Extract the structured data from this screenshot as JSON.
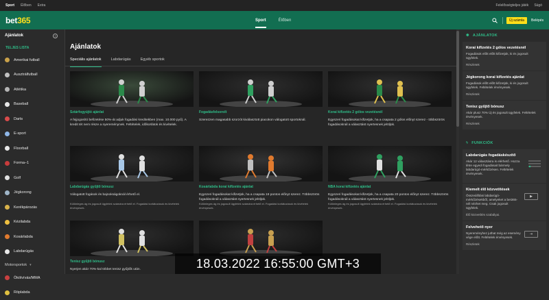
{
  "topbar": {
    "links": [
      "Sport",
      "Élőben",
      "Extra"
    ],
    "right_links": [
      "Felelősségteljes játék",
      "Súgó"
    ]
  },
  "header": {
    "logo_a": "bet",
    "logo_b": "365",
    "tabs": [
      "Sport",
      "Élőben"
    ],
    "join_label": "Új számla",
    "login_label": "Belépés"
  },
  "sidebar": {
    "title": "Ajánlatok",
    "section_title": "TELJES LISTA",
    "items": [
      {
        "label": "Amerikai futball",
        "color": "#c9a14a"
      },
      {
        "label": "Ausztrálfutball",
        "color": "#c0c0c0"
      },
      {
        "label": "Atlétika",
        "color": "#b5b5b5"
      },
      {
        "label": "Baseball",
        "color": "#e6e6e6"
      },
      {
        "label": "Darts",
        "color": "#d94b4b"
      },
      {
        "label": "E-sport",
        "color": "#8fb7e8"
      },
      {
        "label": "Floorball",
        "color": "#e8e8e8"
      },
      {
        "label": "Forma–1",
        "color": "#c93c3c"
      },
      {
        "label": "Golf",
        "color": "#e0e0e0"
      },
      {
        "label": "Jégkorong",
        "color": "#9fb5c8"
      },
      {
        "label": "Kerékpározás",
        "color": "#d8b24a"
      },
      {
        "label": "Kézilabda",
        "color": "#f0c040"
      },
      {
        "label": "Kosárlabda",
        "color": "#e07a2e"
      },
      {
        "label": "Labdarúgás",
        "color": "#e8e8e8"
      }
    ],
    "motorsport_label": "Motorsportok",
    "more_items": [
      {
        "label": "Ökölvívás/MMA",
        "color": "#c94040"
      },
      {
        "label": "Röplabda",
        "color": "#e0c040"
      }
    ]
  },
  "main": {
    "title": "Ajánlatok",
    "tabs": [
      "Speciális ajánlatok",
      "Labdarúgás",
      "Egyéb sportok"
    ],
    "cards": [
      {
        "title": "Sztárfogyújtó ajánlat",
        "desc": "A fejjogosító befizetése 50%-át adjuk fogadási kreditekben (max. 10.000 pyű). A kredit tét nem része a nyereménynek. Feltételek, időkorlátok és kivételek.",
        "small": ""
      },
      {
        "title": "Fogadásfelsorolt",
        "desc": "Szerezzen magasabb szorzót kiválasztott piacokon válogatott sportoknál.",
        "small": ""
      },
      {
        "title": "Korai kifizetés 2 gólos vezetésnél",
        "desc": "Egyszeri fogadásokat kifizetjük, ha a csapata 2 gólos előnyt szerez - többszörös fogadásoknál a választást nyertesnek jelöljük.",
        "small": ""
      },
      {
        "title": "Labdarúgás gyűjtő bónusz",
        "desc": "Válogatott fogások és bajnokságoknál érhető el.",
        "small": "Különleges ág és jogosult ügyfelek számára érhető el. Fogadási korlátozások és kivételek érvényesek."
      },
      {
        "title": "Kosárlabda korai kifizetés ajánlat",
        "desc": "Egyszeri fogadásokat kifizetjük, ha a csapata 18 pontos előnyt szerez. Többszörös fogadásoknál a választást nyertesnek jelöljük.",
        "small": "Különleges ág és jogosult ügyfelek számára érhető el. Fogadási korlátozások és kivételek érvényesek."
      },
      {
        "title": "NBA korai kifizetés ajánlat",
        "desc": "Egyszeri fogadásokat kifizetjük, ha a csapata 20 pontos előnyt szerez. Többszörös fogadásoknál a választást nyertesnek jelöljük.",
        "small": "Különleges ág és jogosult ügyfelek számára érhető el. Fogadási korlátozások és kivételek érvényesek."
      },
      {
        "title": "Tenisz gyűjtő bónusz",
        "desc": "Nyerjen akár 70%-kal többet tenisz gyűjtők után.",
        "small": ""
      },
      {
        "title": "",
        "desc": "",
        "small": ""
      }
    ]
  },
  "right": {
    "offers_title": "AJÁNLATOK",
    "offers": [
      {
        "title": "Korai kifizetés 2 gólos vezetésnél",
        "desc": "Fogadások előtt előtt kifizetjük, ki és jogosult ügyfelek.",
        "link": "Részletek"
      },
      {
        "title": "Jégkorong korai kifizetés ajánlat",
        "desc": "Fogadások előtt előtt kifizetjük, ki és jogosult ügyfelek. Feltételek érvényesek.",
        "link": "Részletek"
      },
      {
        "title": "Tenisz gyűjtő bónusz",
        "desc": "Akár plusz 70% Új és jogosult ügyfelek. Feltételek érvényesek.",
        "link": "Részletek"
      }
    ],
    "features_title": "FUNKCIÓK",
    "features": [
      {
        "title": "Labdarúgás fogadáskészítő",
        "desc": "Akár 12 választásra is elérhető. Hozza létre egyedi fogadásait bármely labdarúgó-mérkőzésen. Feltételek érvényesek.",
        "link": ""
      },
      {
        "title": "Kiemelt élő közvetítések",
        "desc": "Összeállítási labdarúgó-mérkőzésekből, amelyeket a bet365-nél nézhet meg. Csak jogosult ügyfelek.",
        "link": "Élő közvetítés szabályai."
      },
      {
        "title": "Felvehető nyer",
        "desc": "Nyereményhez juthat még az esemény vége előtt. Feltételek érvényesek.",
        "link": "Részletek"
      }
    ]
  },
  "overlay": {
    "timestamp": "18.03.2022   16:55:00   GMT+3"
  },
  "colors": {
    "brand": "#126e51",
    "accent": "#2fbf8a",
    "button": "#ffdf1b"
  }
}
